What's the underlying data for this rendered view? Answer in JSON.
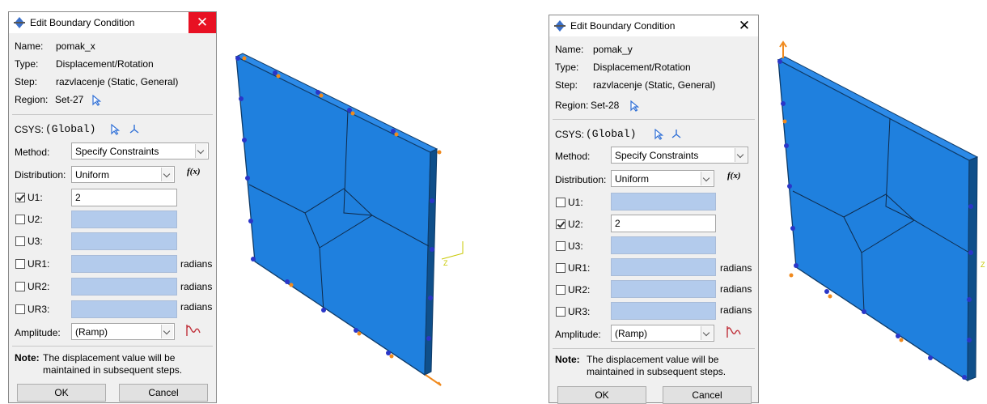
{
  "dialog_left": {
    "title": "Edit Boundary Condition",
    "close_glyph": "✕",
    "name_label": "Name:",
    "name_value": "pomak_x",
    "type_label": "Type:",
    "type_value": "Displacement/Rotation",
    "step_label": "Step:",
    "step_value": "razvlacenje (Static, General)",
    "region_label": "Region:",
    "region_value": "Set-27",
    "csys_label": "CSYS:",
    "csys_value": "(Global)",
    "method_label": "Method:",
    "method_value": "Specify Constraints",
    "distribution_label": "Distribution:",
    "distribution_value": "Uniform",
    "fx_label": "f(x)",
    "dofs": [
      {
        "label": "U1:",
        "checked": true,
        "value": "2",
        "unit": ""
      },
      {
        "label": "U2:",
        "checked": false,
        "value": "",
        "unit": ""
      },
      {
        "label": "U3:",
        "checked": false,
        "value": "",
        "unit": ""
      },
      {
        "label": "UR1:",
        "checked": false,
        "value": "",
        "unit": "radians"
      },
      {
        "label": "UR2:",
        "checked": false,
        "value": "",
        "unit": "radians"
      },
      {
        "label": "UR3:",
        "checked": false,
        "value": "",
        "unit": "radians"
      }
    ],
    "amplitude_label": "Amplitude:",
    "amplitude_value": "(Ramp)",
    "note_label": "Note:",
    "note_line1": "The displacement value will be",
    "note_line2": "maintained in subsequent steps.",
    "ok_label": "OK",
    "cancel_label": "Cancel"
  },
  "dialog_right": {
    "title": "Edit Boundary Condition",
    "close_glyph": "✕",
    "name_label": "Name:",
    "name_value": "pomak_y",
    "type_label": "Type:",
    "type_value": "Displacement/Rotation",
    "step_label": "Step:",
    "step_value": "razvlacenje (Static, General)",
    "region_label": "Region:",
    "region_value": "Set-28",
    "csys_label": "CSYS:",
    "csys_value": "(Global)",
    "method_label": "Method:",
    "method_value": "Specify Constraints",
    "distribution_label": "Distribution:",
    "distribution_value": "Uniform",
    "fx_label": "f(x)",
    "dofs": [
      {
        "label": "U1:",
        "checked": false,
        "value": "",
        "unit": ""
      },
      {
        "label": "U2:",
        "checked": true,
        "value": "2",
        "unit": ""
      },
      {
        "label": "U3:",
        "checked": false,
        "value": "",
        "unit": ""
      },
      {
        "label": "UR1:",
        "checked": false,
        "value": "",
        "unit": "radians"
      },
      {
        "label": "UR2:",
        "checked": false,
        "value": "",
        "unit": "radians"
      },
      {
        "label": "UR3:",
        "checked": false,
        "value": "",
        "unit": "radians"
      }
    ],
    "amplitude_label": "Amplitude:",
    "amplitude_value": "(Ramp)",
    "note_label": "Note:",
    "note_line1": "The displacement value will be",
    "note_line2": "maintained in subsequent steps.",
    "ok_label": "OK",
    "cancel_label": "Cancel"
  },
  "viewport_left": {
    "triad_label": "Z"
  },
  "viewport_right": {
    "triad_label": "Z"
  },
  "colors": {
    "plate_face": "#1f80de",
    "plate_edge": "#0f4f8a",
    "bc_marker": "#2a36c8",
    "load_marker": "#f08a1e",
    "empty_field": "#b3cbec",
    "close_active": "#e81123"
  }
}
